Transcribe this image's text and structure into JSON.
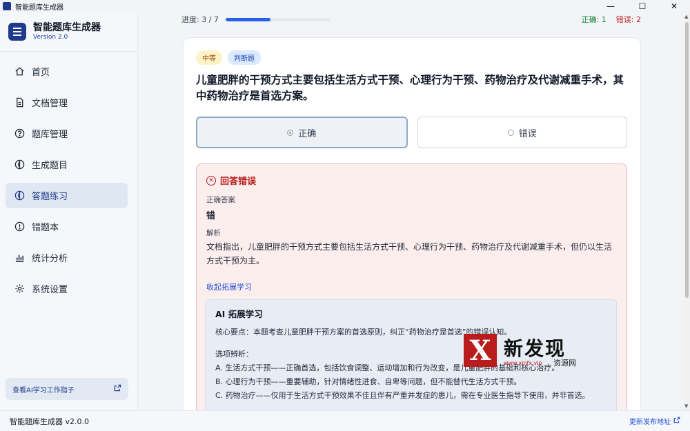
{
  "window": {
    "title": "智能题库生成器",
    "controls": {
      "minimize": "—",
      "maximize": "☐",
      "close": "✕"
    }
  },
  "sidebar": {
    "brand_name": "智能题库生成器",
    "brand_version": "Version 2.0",
    "items": [
      {
        "label": "首页",
        "icon": "home-icon"
      },
      {
        "label": "文档管理",
        "icon": "document-icon"
      },
      {
        "label": "题库管理",
        "icon": "question-icon"
      },
      {
        "label": "生成题目",
        "icon": "ai-generate-icon"
      },
      {
        "label": "答题练习",
        "icon": "practice-icon",
        "active": true
      },
      {
        "label": "错题本",
        "icon": "alert-icon"
      },
      {
        "label": "统计分析",
        "icon": "chart-icon"
      },
      {
        "label": "系统设置",
        "icon": "gear-icon"
      }
    ],
    "bottom_link": "查看AI学习工作指子"
  },
  "main": {
    "progress_label": "进度: 3 / 7",
    "progress_fraction": 0.4286,
    "score_correct": "正确: 1",
    "score_wrong": "错误: 2",
    "tag_level": "中等",
    "tag_type": "判断题",
    "question": "儿童肥胖的干预方式主要包括生活方式干预、心理行为干预、药物治疗及代谢减重手术，其中药物治疗是首选方案。",
    "options": [
      {
        "label": "正确",
        "selected": true
      },
      {
        "label": "错误",
        "selected": false
      }
    ],
    "feedback": {
      "title": "回答错误",
      "answer_label": "正确答案",
      "answer": "错",
      "explanation_label": "解析",
      "explanation": "文档指出，儿童肥胖的干预方式主要包括生活方式干预、心理行为干预、药物治疗及代谢减重手术，但仍以生活方式干预为主。",
      "toggle": "收起拓展学习"
    },
    "ai": {
      "title": "AI 拓展学习",
      "line1": "核心要点：本题考查儿童肥胖干预方案的首选原则，纠正“药物治疗是首选”的错误认知。",
      "line2": "选项辨析：",
      "line3": "A. 生活方式干预——正确首选，包括饮食调整、运动增加和行为改变，是儿童肥胖的基础和核心治疗。",
      "line4": "B. 心理行为干预——重要辅助，针对情绪性进食、自卑等问题，但不能替代生活方式干预。",
      "line5": "C. 药物治疗——仅用于生活方式干预效果不佳且伴有严重并发症的患儿，需在专业医生指导下使用，并非首选。"
    }
  },
  "statusbar": {
    "left": "智能题库生成器 v2.0.0",
    "right": "更新发布地址"
  },
  "watermark": {
    "mark": "X",
    "name": "新发现",
    "url": "www.xinfx.vip",
    "sub": "资源网"
  },
  "colors": {
    "accent": "#1e3a8a",
    "progress": "#2563eb",
    "correct": "#15803d",
    "wrong": "#b91c1c"
  }
}
